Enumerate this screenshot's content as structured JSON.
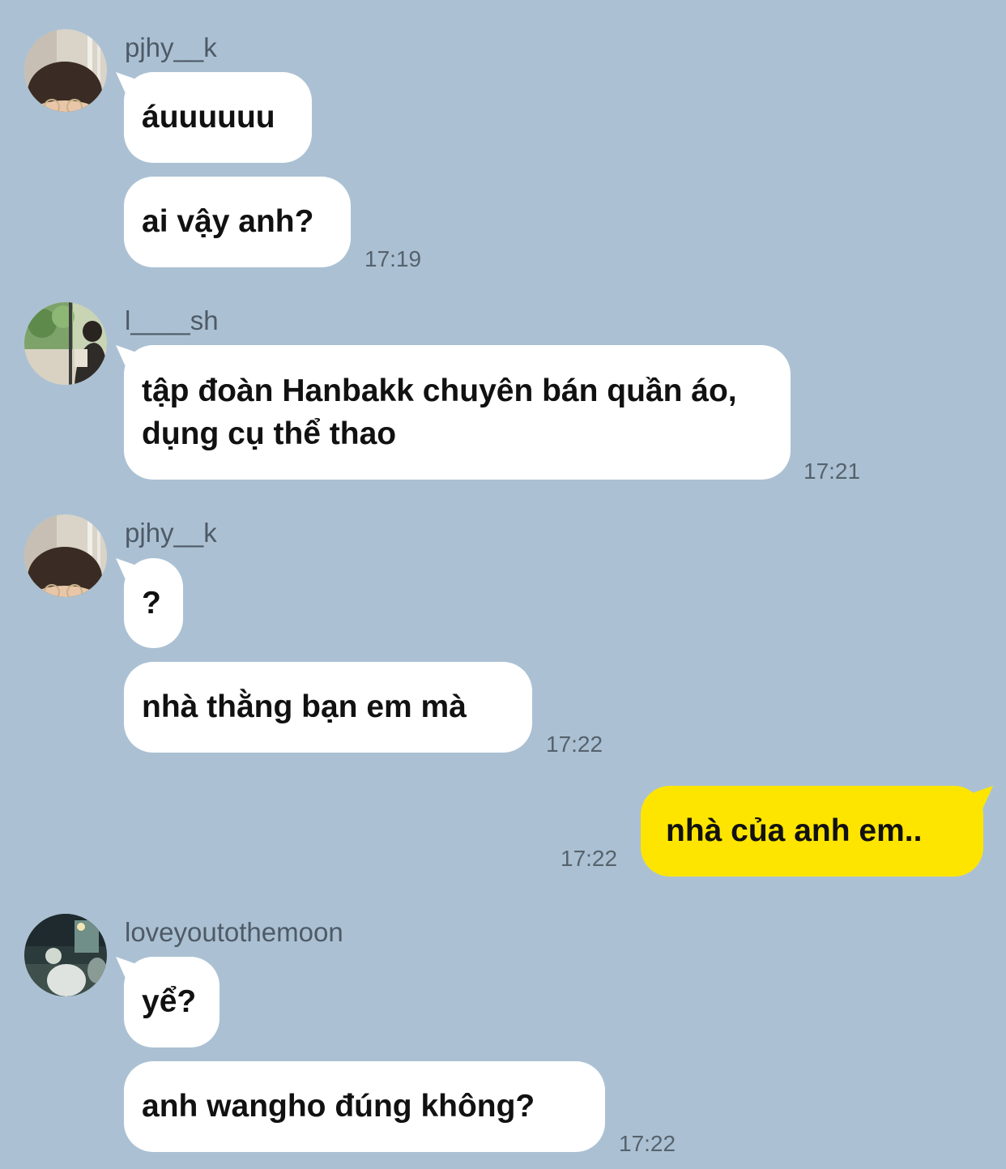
{
  "chat": {
    "groups": [
      {
        "sender": "pjhy__k",
        "avatar_icon": "profile-photo-glasses-boy",
        "messages": [
          "áuuuuuu",
          "ai vậy anh?"
        ],
        "time": "17:19"
      },
      {
        "sender": "l____sh",
        "avatar_icon": "profile-photo-window-reading",
        "messages": [
          "tập đoàn Hanbakk chuyên bán quần áo, dụng cụ thể thao"
        ],
        "time": "17:21"
      },
      {
        "sender": "pjhy__k",
        "avatar_icon": "profile-photo-glasses-boy",
        "messages": [
          "?",
          "nhà thằng bạn em mà"
        ],
        "time": "17:22"
      },
      {
        "sender": "me",
        "messages": [
          "nhà của anh em.."
        ],
        "time": "17:22"
      },
      {
        "sender": "loveyoutothemoon",
        "avatar_icon": "profile-photo-night-street",
        "messages": [
          "yể?",
          "anh wangho đúng không?"
        ],
        "time": "17:22"
      }
    ]
  },
  "colors": {
    "background": "#abc1d3",
    "incoming_bubble": "#ffffff",
    "outgoing_bubble": "#fee500",
    "name_text": "#4e5a66",
    "time_text": "#56626d"
  }
}
